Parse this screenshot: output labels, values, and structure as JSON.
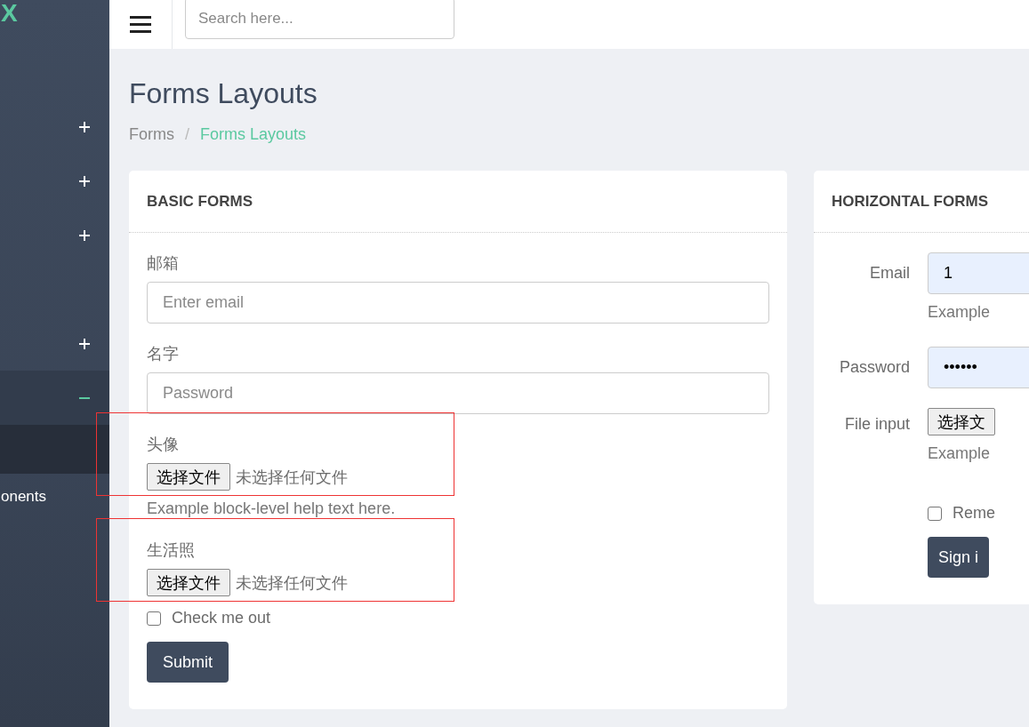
{
  "sidebar": {
    "logo": "X",
    "items": [
      {
        "kind": "group",
        "expanded": false
      },
      {
        "kind": "group",
        "expanded": false
      },
      {
        "kind": "group",
        "expanded": false
      },
      {
        "kind": "link"
      },
      {
        "kind": "group",
        "expanded": false
      },
      {
        "kind": "group",
        "expanded": true,
        "children": [
          {
            "selected": true
          }
        ]
      },
      {
        "kind": "link",
        "label": "onents"
      }
    ]
  },
  "topbar": {
    "search": {
      "placeholder": "Search here..."
    }
  },
  "page": {
    "title": "Forms Layouts",
    "breadcrumb": [
      {
        "label": "Forms",
        "active": false
      },
      {
        "label": "Forms Layouts",
        "active": true
      }
    ],
    "separator": "/"
  },
  "basic_forms": {
    "title": "BASIC FORMS",
    "fields": [
      {
        "kind": "text",
        "label": "邮箱",
        "placeholder": "Enter email"
      },
      {
        "kind": "text",
        "label": "名字",
        "placeholder": "Password"
      },
      {
        "kind": "file",
        "label": "头像",
        "button": "选择文件",
        "status": "未选择任何文件",
        "help": "Example block-level help text here.",
        "annotated": true
      },
      {
        "kind": "file",
        "label": "生活照",
        "button": "选择文件",
        "status": "未选择任何文件",
        "annotated": true
      }
    ],
    "checkbox": {
      "label": "Check me out",
      "checked": false
    },
    "submit": "Submit"
  },
  "horizontal_forms": {
    "title": "HORIZONTAL FORMS",
    "fields": [
      {
        "kind": "text",
        "label": "Email",
        "value": "1",
        "help": "Example"
      },
      {
        "kind": "text",
        "label": "Password",
        "value": "••••••"
      },
      {
        "kind": "file",
        "label": "File input",
        "button": "选择文",
        "help": "Example"
      }
    ],
    "checkbox": {
      "label": "Reme",
      "checked": false
    },
    "submit": "Sign i"
  }
}
